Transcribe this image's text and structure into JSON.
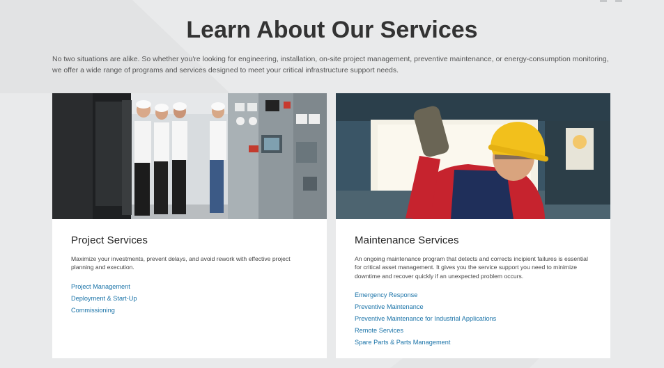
{
  "header": {
    "title": "Learn About Our Services",
    "intro": "No two situations are alike. So whether you're looking for engineering, installation, on-site project management, preventive maintenance, or energy-consumption monitoring, we offer a wide range of programs and services designed to meet your critical infrastructure support needs."
  },
  "cards": [
    {
      "title": "Project Services",
      "description": "Maximize your investments, prevent delays, and avoid rework with effective project planning and execution.",
      "links": [
        "Project Management",
        "Deployment & Start-Up",
        "Commissioning"
      ]
    },
    {
      "title": "Maintenance Services",
      "description": "An ongoing maintenance program that detects and corrects incipient failures is essential for critical asset management. It gives you the service support you need to minimize downtime and recover quickly if an unexpected problem occurs.",
      "links": [
        "Emergency Response",
        "Preventive Maintenance",
        "Preventive Maintenance for Industrial Applications",
        "Remote Services",
        "Spare Parts & Parts Management"
      ]
    }
  ],
  "colors": {
    "background": "#e9eaeb",
    "link": "#1a73a8",
    "heading": "#333333"
  }
}
